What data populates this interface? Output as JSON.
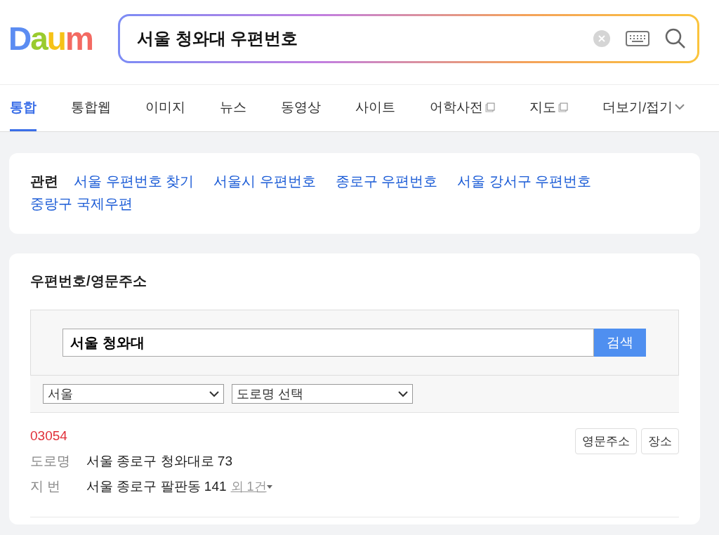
{
  "logo": "Daum",
  "search": {
    "value": "서울 청와대 우편번호"
  },
  "tabs": [
    {
      "label": "통합",
      "selected": true,
      "kind": "plain"
    },
    {
      "label": "통합웹",
      "selected": false,
      "kind": "plain"
    },
    {
      "label": "이미지",
      "selected": false,
      "kind": "plain"
    },
    {
      "label": "뉴스",
      "selected": false,
      "kind": "plain"
    },
    {
      "label": "동영상",
      "selected": false,
      "kind": "plain"
    },
    {
      "label": "사이트",
      "selected": false,
      "kind": "plain"
    },
    {
      "label": "어학사전",
      "selected": false,
      "kind": "popup"
    },
    {
      "label": "지도",
      "selected": false,
      "kind": "popup"
    },
    {
      "label": "더보기/접기",
      "selected": false,
      "kind": "more"
    }
  ],
  "related": {
    "title": "관련",
    "links": [
      "서울 우편번호 찾기",
      "서울시 우편번호",
      "종로구 우편번호",
      "서울 강서구 우편번호",
      "중랑구 국제우편"
    ]
  },
  "postal": {
    "title": "우편번호/영문주소",
    "query": {
      "value": "서울 청와대",
      "button": "검색"
    },
    "selects": [
      "서울",
      "도로명 선택"
    ],
    "results": [
      {
        "code": "03054",
        "buttons": [
          "영문주소",
          "장소"
        ],
        "road_label": "도로명",
        "road": "서울 종로구 청와대로 73",
        "lot_label": "지 번",
        "lot": "서울 종로구 팔판동 141",
        "more": "외 1건"
      }
    ]
  }
}
